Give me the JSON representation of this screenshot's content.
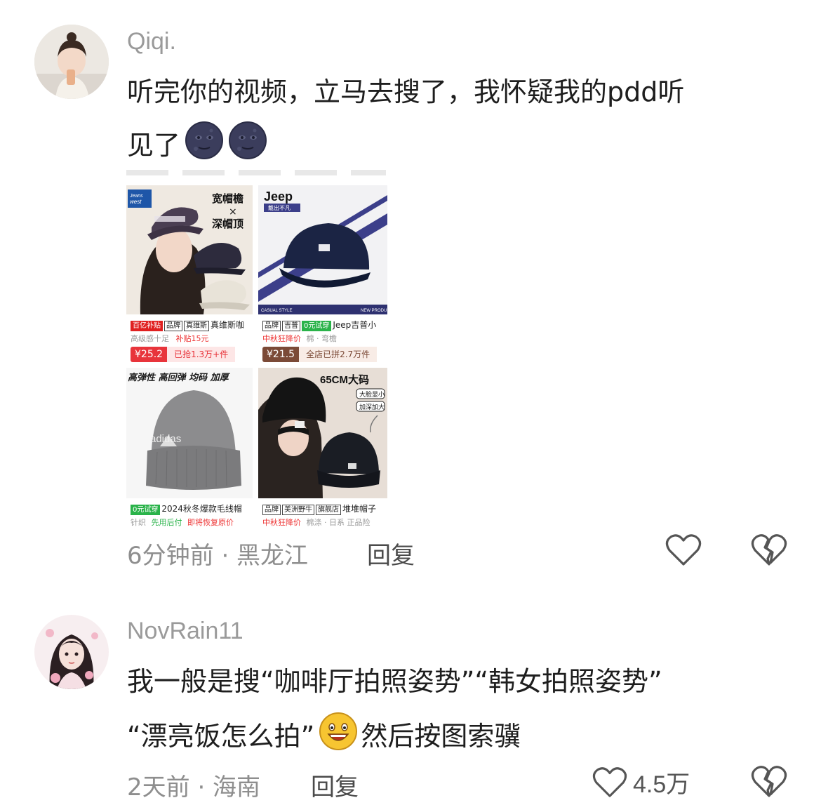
{
  "comments": [
    {
      "username": "Qiqi.",
      "text_line1": "听完你的视频，立马去搜了，我怀疑我的pdd听",
      "text_line2": "见了",
      "emojis": [
        "new-moon-face",
        "new-moon-face"
      ],
      "meta": "6分钟前 · 黑龙江",
      "reply_label": "回复",
      "like_count": "",
      "attachment": {
        "products": [
          {
            "overlay_text": [
              "宽帽檐",
              "×",
              "深帽顶"
            ],
            "brand_logo": "Jeans west",
            "tags": [
              "百亿补贴",
              "品牌",
              "真维斯"
            ],
            "title": "真维斯咖",
            "sub": "高级感十足",
            "subsidy": "补贴15元",
            "price": "¥25.2",
            "sold": "已抢1.3万+件"
          },
          {
            "overlay_text": [
              "Jeep",
              "戴出不凡"
            ],
            "tags": [
              "品牌",
              "吉普",
              "0元试穿"
            ],
            "title": "Jeep吉普小",
            "sub_promo": "中秋狂降价",
            "sub": "棉 · 弯檐",
            "price": "¥21.5",
            "sold": "全店已拼2.7万件",
            "caption_left": "CASUAL STYLE",
            "caption_right": "NEW PRODU"
          },
          {
            "overlay_text": [
              "高弹性 高回弹 均码 加厚"
            ],
            "tags": [
              "0元试穿"
            ],
            "title": "2024秋冬爆款毛线帽",
            "sub": "针织",
            "sub_green": "先用后付",
            "sub_red": "即将恢复原价",
            "brand_text": "adidas"
          },
          {
            "overlay_text": [
              "65CM大码",
              "大脸显小",
              "加深加大"
            ],
            "tags": [
              "品牌",
              "美洲野牛",
              "旗舰店"
            ],
            "title": "堆堆帽子",
            "sub_promo": "中秋狂降价",
            "sub": "棉涤 · 日系  正品险"
          }
        ]
      }
    },
    {
      "username": "NovRain11",
      "text_line1": "我一般是搜“咖啡厅拍照姿势”“韩女拍照姿势”",
      "text_line2": "“漂亮饭怎么拍”",
      "text_line2_after": "然后按图索骥",
      "emojis": [
        "grinning-face"
      ],
      "meta": "2天前 · 海南",
      "reply_label": "回复",
      "like_count": "4.5万"
    }
  ],
  "colors": {
    "text": "#1e1e1e",
    "meta": "#8e8e8e",
    "username": "#9a9a9a",
    "price_red": "#e8343b"
  }
}
